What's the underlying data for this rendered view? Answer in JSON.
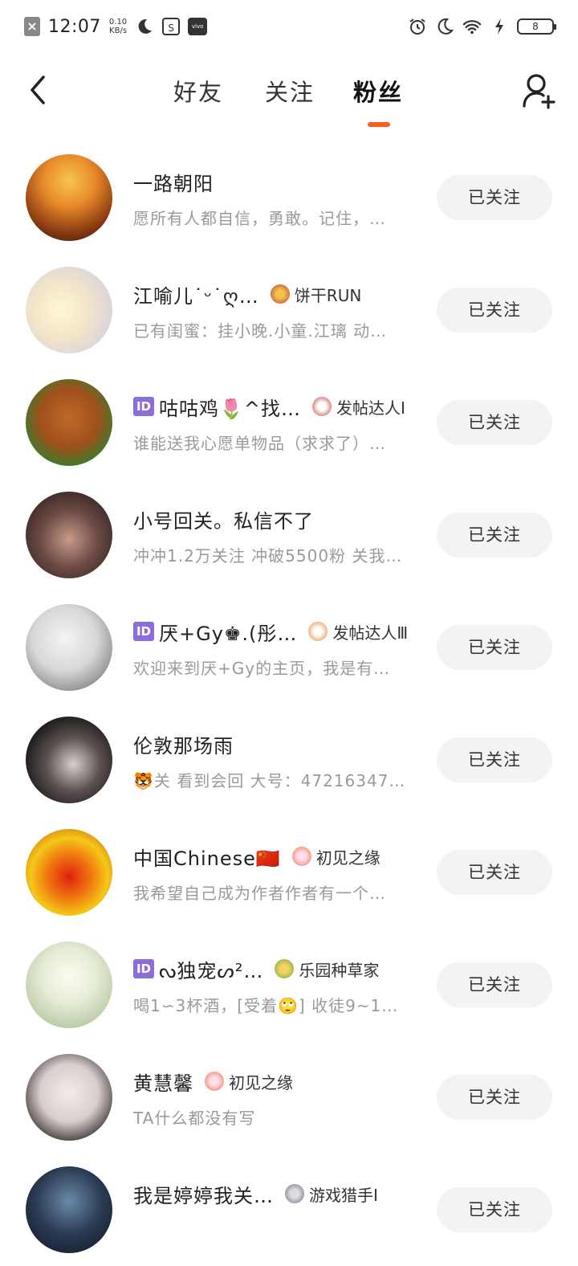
{
  "status_bar": {
    "time": "12:07",
    "speed_value": "0.10",
    "speed_unit": "KB/s",
    "battery": "8",
    "icons": [
      "notification-x-icon",
      "moon-icon",
      "s-app-icon",
      "vivo-icon",
      "alarm-icon",
      "moon-icon",
      "wifi-icon",
      "charging-icon",
      "battery-icon"
    ]
  },
  "header": {
    "tabs": [
      {
        "label": "好友"
      },
      {
        "label": "关注"
      },
      {
        "label": "粉丝"
      }
    ],
    "active_tab": 2,
    "accent_color": "#ff5a1f"
  },
  "fans": [
    {
      "name": "一路朝阳",
      "id_badge": false,
      "badge_label": "",
      "desc": "愿所有人都自信，勇敢。记住，…",
      "button": "已关注"
    },
    {
      "name": "江喻儿˙ᵕ˙ღ…",
      "id_badge": false,
      "badge_label": "饼干RUN",
      "desc": "已有闺蜜：挂小晚.小童.江璃 动…",
      "button": "已关注"
    },
    {
      "name": "咕咕鸡🌷^找…",
      "id_badge": true,
      "badge_label": "发帖达人Ⅰ",
      "desc": "谁能送我心愿单物品（求求了）…",
      "button": "已关注"
    },
    {
      "name": "小号回关。私信不了",
      "id_badge": false,
      "badge_label": "",
      "desc": "冲冲1.2万关注 冲破5500粉 关我…",
      "button": "已关注"
    },
    {
      "name": "厌+Gy♚.(彤…",
      "id_badge": true,
      "badge_label": "发帖达人Ⅲ",
      "desc": "欢迎来到厌+Gy的主页，我是有…",
      "button": "已关注"
    },
    {
      "name": "伦敦那场雨",
      "id_badge": false,
      "badge_label": "",
      "desc": "🐯关  看到会回 大号：47216347…",
      "button": "已关注"
    },
    {
      "name": "中国Chinese🇨🇳",
      "id_badge": false,
      "badge_label": "初见之缘",
      "desc": "我希望自己成为作者作者有一个…",
      "button": "已关注"
    },
    {
      "name": "ᔓ独宠ᔕ²…",
      "id_badge": true,
      "badge_label": "乐园种草家",
      "desc": "喝1∽3杯酒，[受着🙄] 收徒9~1…",
      "button": "已关注"
    },
    {
      "name": "黄慧馨",
      "id_badge": false,
      "badge_label": "初见之缘",
      "desc": "TA什么都没有写",
      "button": "已关注"
    },
    {
      "name": "我是婷婷我关…",
      "id_badge": false,
      "badge_label": "游戏猎手Ⅰ",
      "desc": "",
      "button": "已关注"
    }
  ]
}
